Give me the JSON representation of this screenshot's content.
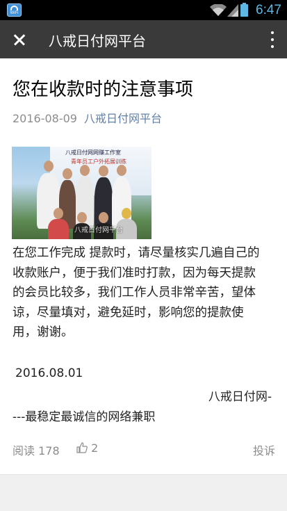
{
  "status_bar": {
    "app_icon": "wifi-app-icon",
    "app_icon_label": "WiFi",
    "time": "6:47",
    "accent": "#5fb7e5"
  },
  "app_bar": {
    "close_icon": "close-icon",
    "title": "八戒日付网平台",
    "more_icon": "more-vertical-icon",
    "background": "#3a3a3a"
  },
  "article": {
    "title": "您在收款时的注意事项",
    "date": "2016-08-09",
    "author": "八戒日付网平台",
    "author_color": "#607fa6",
    "image": {
      "banner_line1": "八戒日付网网赚工作室",
      "banner_line2": "青年员工户外拓展训练",
      "watermark": "八戒日付网平台"
    },
    "body_lines": [
      "在您工作完成 提款时，请尽量核实几遍自己的",
      "收款账户，便于我们准时打款，因为每天提款",
      "的会员比较多，我们工作人员非常辛苦，望体",
      "谅，尽量填对，避免延时，影响您的提款使",
      "用，谢谢。"
    ],
    "sign_date": "2016.08.01",
    "signature_line1": "八戒日付网-",
    "signature_line2": "---最稳定最诚信的网络兼职"
  },
  "footer": {
    "reads_label": "阅读",
    "reads_count": "178",
    "like_icon": "thumbs-up-icon",
    "likes_count": "2",
    "report_label": "投诉"
  }
}
